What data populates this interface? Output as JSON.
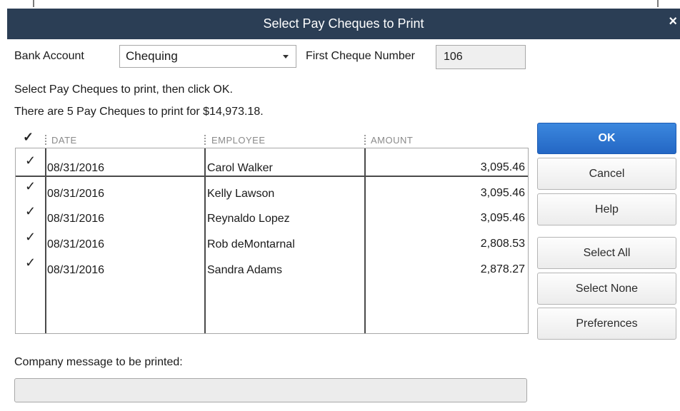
{
  "window": {
    "title": "Select Pay Cheques to Print",
    "close_glyph": "×"
  },
  "bank_account": {
    "label": "Bank Account",
    "value": "Chequing"
  },
  "first_cheque": {
    "label": "First Cheque Number",
    "value": "106"
  },
  "instructions": {
    "line1": "Select Pay Cheques to print, then click OK.",
    "line2": "There are 5 Pay Cheques to print for $14,973.18."
  },
  "table": {
    "check_header": "✓",
    "columns": {
      "date": "DATE",
      "employee": "EMPLOYEE",
      "amount": "AMOUNT"
    },
    "rows": [
      {
        "checked": "✓",
        "date": "08/31/2016",
        "employee": "Carol Walker",
        "amount": "3,095.46"
      },
      {
        "checked": "✓",
        "date": "08/31/2016",
        "employee": "Kelly Lawson",
        "amount": "3,095.46"
      },
      {
        "checked": "✓",
        "date": "08/31/2016",
        "employee": "Reynaldo Lopez",
        "amount": "3,095.46"
      },
      {
        "checked": "✓",
        "date": "08/31/2016",
        "employee": "Rob deMontarnal",
        "amount": "2,808.53"
      },
      {
        "checked": "✓",
        "date": "08/31/2016",
        "employee": "Sandra Adams",
        "amount": "2,878.27"
      }
    ]
  },
  "buttons": {
    "ok": "OK",
    "cancel": "Cancel",
    "help": "Help",
    "select_all": "Select All",
    "select_none": "Select None",
    "preferences": "Preferences"
  },
  "company_message": {
    "label": "Company message to be printed:",
    "value": ""
  },
  "colors": {
    "titlebar": "#2b3e55",
    "primary_button": "#2a6fcf"
  }
}
